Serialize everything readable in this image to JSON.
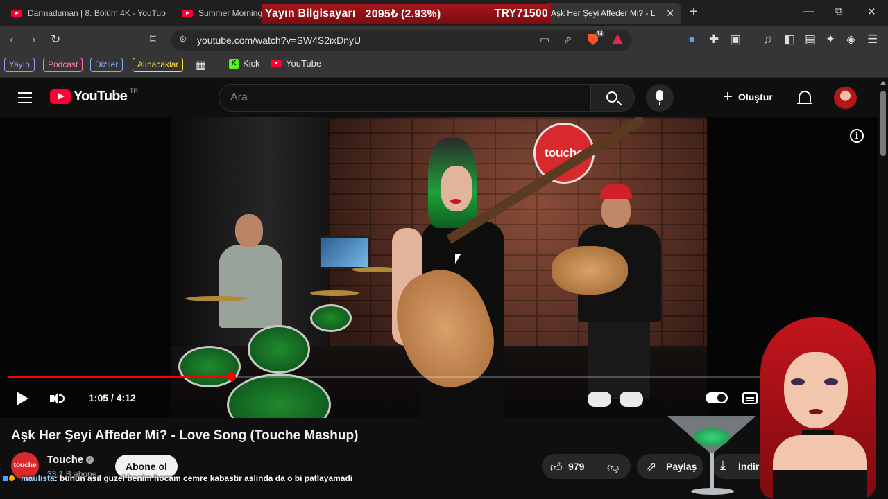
{
  "browser": {
    "tabs": [
      {
        "title": "Darmaduman | 8. Bölüm 4K - YouTub"
      },
      {
        "title": "Summer Morning"
      },
      {
        "title": "Aşk Her Şeyi Affeder Mi? - Lo"
      }
    ],
    "new_tab_symbol": "+",
    "window": {
      "minimize": "—",
      "restore": "⧉",
      "close": "✕"
    },
    "url": "youtube.com/watch?v=SW4S2ixDnyU",
    "brave_badge": "14",
    "bookmarks": {
      "pills": [
        {
          "label": "Yayın",
          "color": "#b889ff"
        },
        {
          "label": "Podcast",
          "color": "#ff7ab5"
        },
        {
          "label": "Diziler",
          "color": "#7fb0ff"
        },
        {
          "label": "Alınacaklar",
          "color": "#ffd84a"
        }
      ],
      "links": [
        {
          "label": "Kick",
          "icon": "kick-icon"
        },
        {
          "label": "YouTube",
          "icon": "youtube-icon"
        }
      ]
    }
  },
  "ticker": {
    "label": "Yayın Bilgisayarı",
    "price_change": "2095₺ (2.93%)",
    "price": "TRY71500"
  },
  "youtube": {
    "logo_text": "YouTube",
    "country_code": "TR",
    "search_placeholder": "Ara",
    "create_label": "Oluştur",
    "player": {
      "time": "1:05 / 4:12",
      "progress_fraction": 0.258,
      "logo_sign": "touche"
    },
    "video": {
      "title": "Aşk Her Şeyi Affeder Mi? - Love Song (Touche Mashup)",
      "channel": "Touche",
      "channel_avatar_text": "touche",
      "subscribers": "33,1 B abone",
      "subscribe_label": "Abone ol",
      "likes": "979",
      "share_label": "Paylaş",
      "download_label": "İndir"
    }
  },
  "chat": {
    "user": "maulista",
    "message": ": bunun asil guzel benim hocam cemre kabastir aslinda da o bi patlayamadi"
  },
  "colors": {
    "accent": "#ff0033",
    "ticker_bg": "#a4141a",
    "background": "#0f0f0f"
  }
}
